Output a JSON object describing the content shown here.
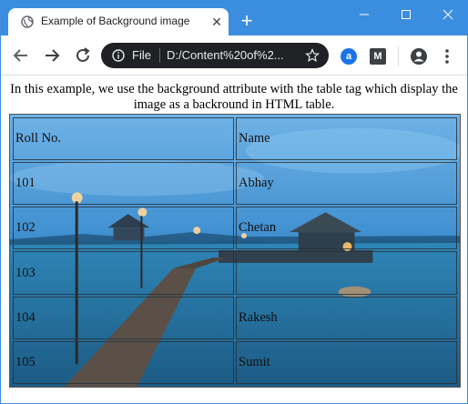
{
  "browser": {
    "tab": {
      "title": "Example of Background image",
      "favicon": "globe-icon",
      "close": "close-icon"
    },
    "new_tab": "plus-icon",
    "omnibox": {
      "scheme_label": "File",
      "url": "D:/Content%20of%2..."
    },
    "extensions": [
      {
        "name": "a-extension-icon",
        "glyph": "a"
      },
      {
        "name": "m-extension-icon",
        "glyph": "M"
      }
    ],
    "accent": "#3b8ddf"
  },
  "page": {
    "intro": "In this example, we use the background attribute with the table tag which display the image as a backround in HTML table.",
    "table": {
      "rows": [
        [
          "Roll No.",
          "Name"
        ],
        [
          "101",
          "Abhay"
        ],
        [
          "102",
          "Chetan"
        ],
        [
          "103",
          ""
        ],
        [
          "104",
          "Rakesh"
        ],
        [
          "105",
          "Sumit"
        ]
      ]
    }
  }
}
